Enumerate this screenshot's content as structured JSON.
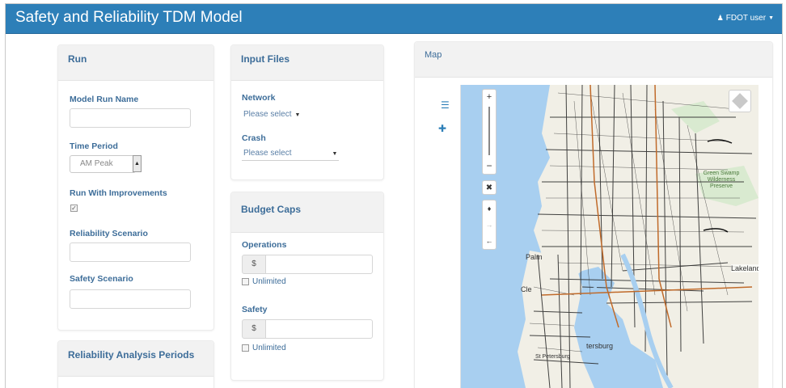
{
  "app": {
    "title": "Safety and Reliability TDM Model",
    "user_label": "FDOT user"
  },
  "run": {
    "heading": "Run",
    "model_run_name_label": "Model Run Name",
    "model_run_name_value": "",
    "time_period_label": "Time Period",
    "time_period_value": "AM Peak",
    "run_with_improvements_label": "Run With Improvements",
    "run_with_improvements_checked": true,
    "reliability_scenario_label": "Reliability Scenario",
    "reliability_scenario_value": "",
    "safety_scenario_label": "Safety Scenario",
    "safety_scenario_value": ""
  },
  "reliability_periods": {
    "heading": "Reliability Analysis Periods"
  },
  "input_files": {
    "heading": "Input Files",
    "network_label": "Network",
    "network_value": "Please select",
    "crash_label": "Crash",
    "crash_value": "Please select"
  },
  "budget_caps": {
    "heading": "Budget Caps",
    "operations_label": "Operations",
    "operations_currency": "$",
    "operations_value": "",
    "operations_unlimited_label": "Unlimited",
    "safety_label": "Safety",
    "safety_currency": "$",
    "safety_value": "",
    "safety_unlimited_label": "Unlimited"
  },
  "map": {
    "heading": "Map",
    "place_labels": [
      "Lakeland",
      "Green Swamp Wilderness Preserve",
      "Palm",
      "Cle",
      "tersburg",
      "St Petersburg"
    ]
  },
  "colors": {
    "navbar": "#2d7fb8",
    "label": "#3d6d99",
    "water": "#a8cff0"
  }
}
